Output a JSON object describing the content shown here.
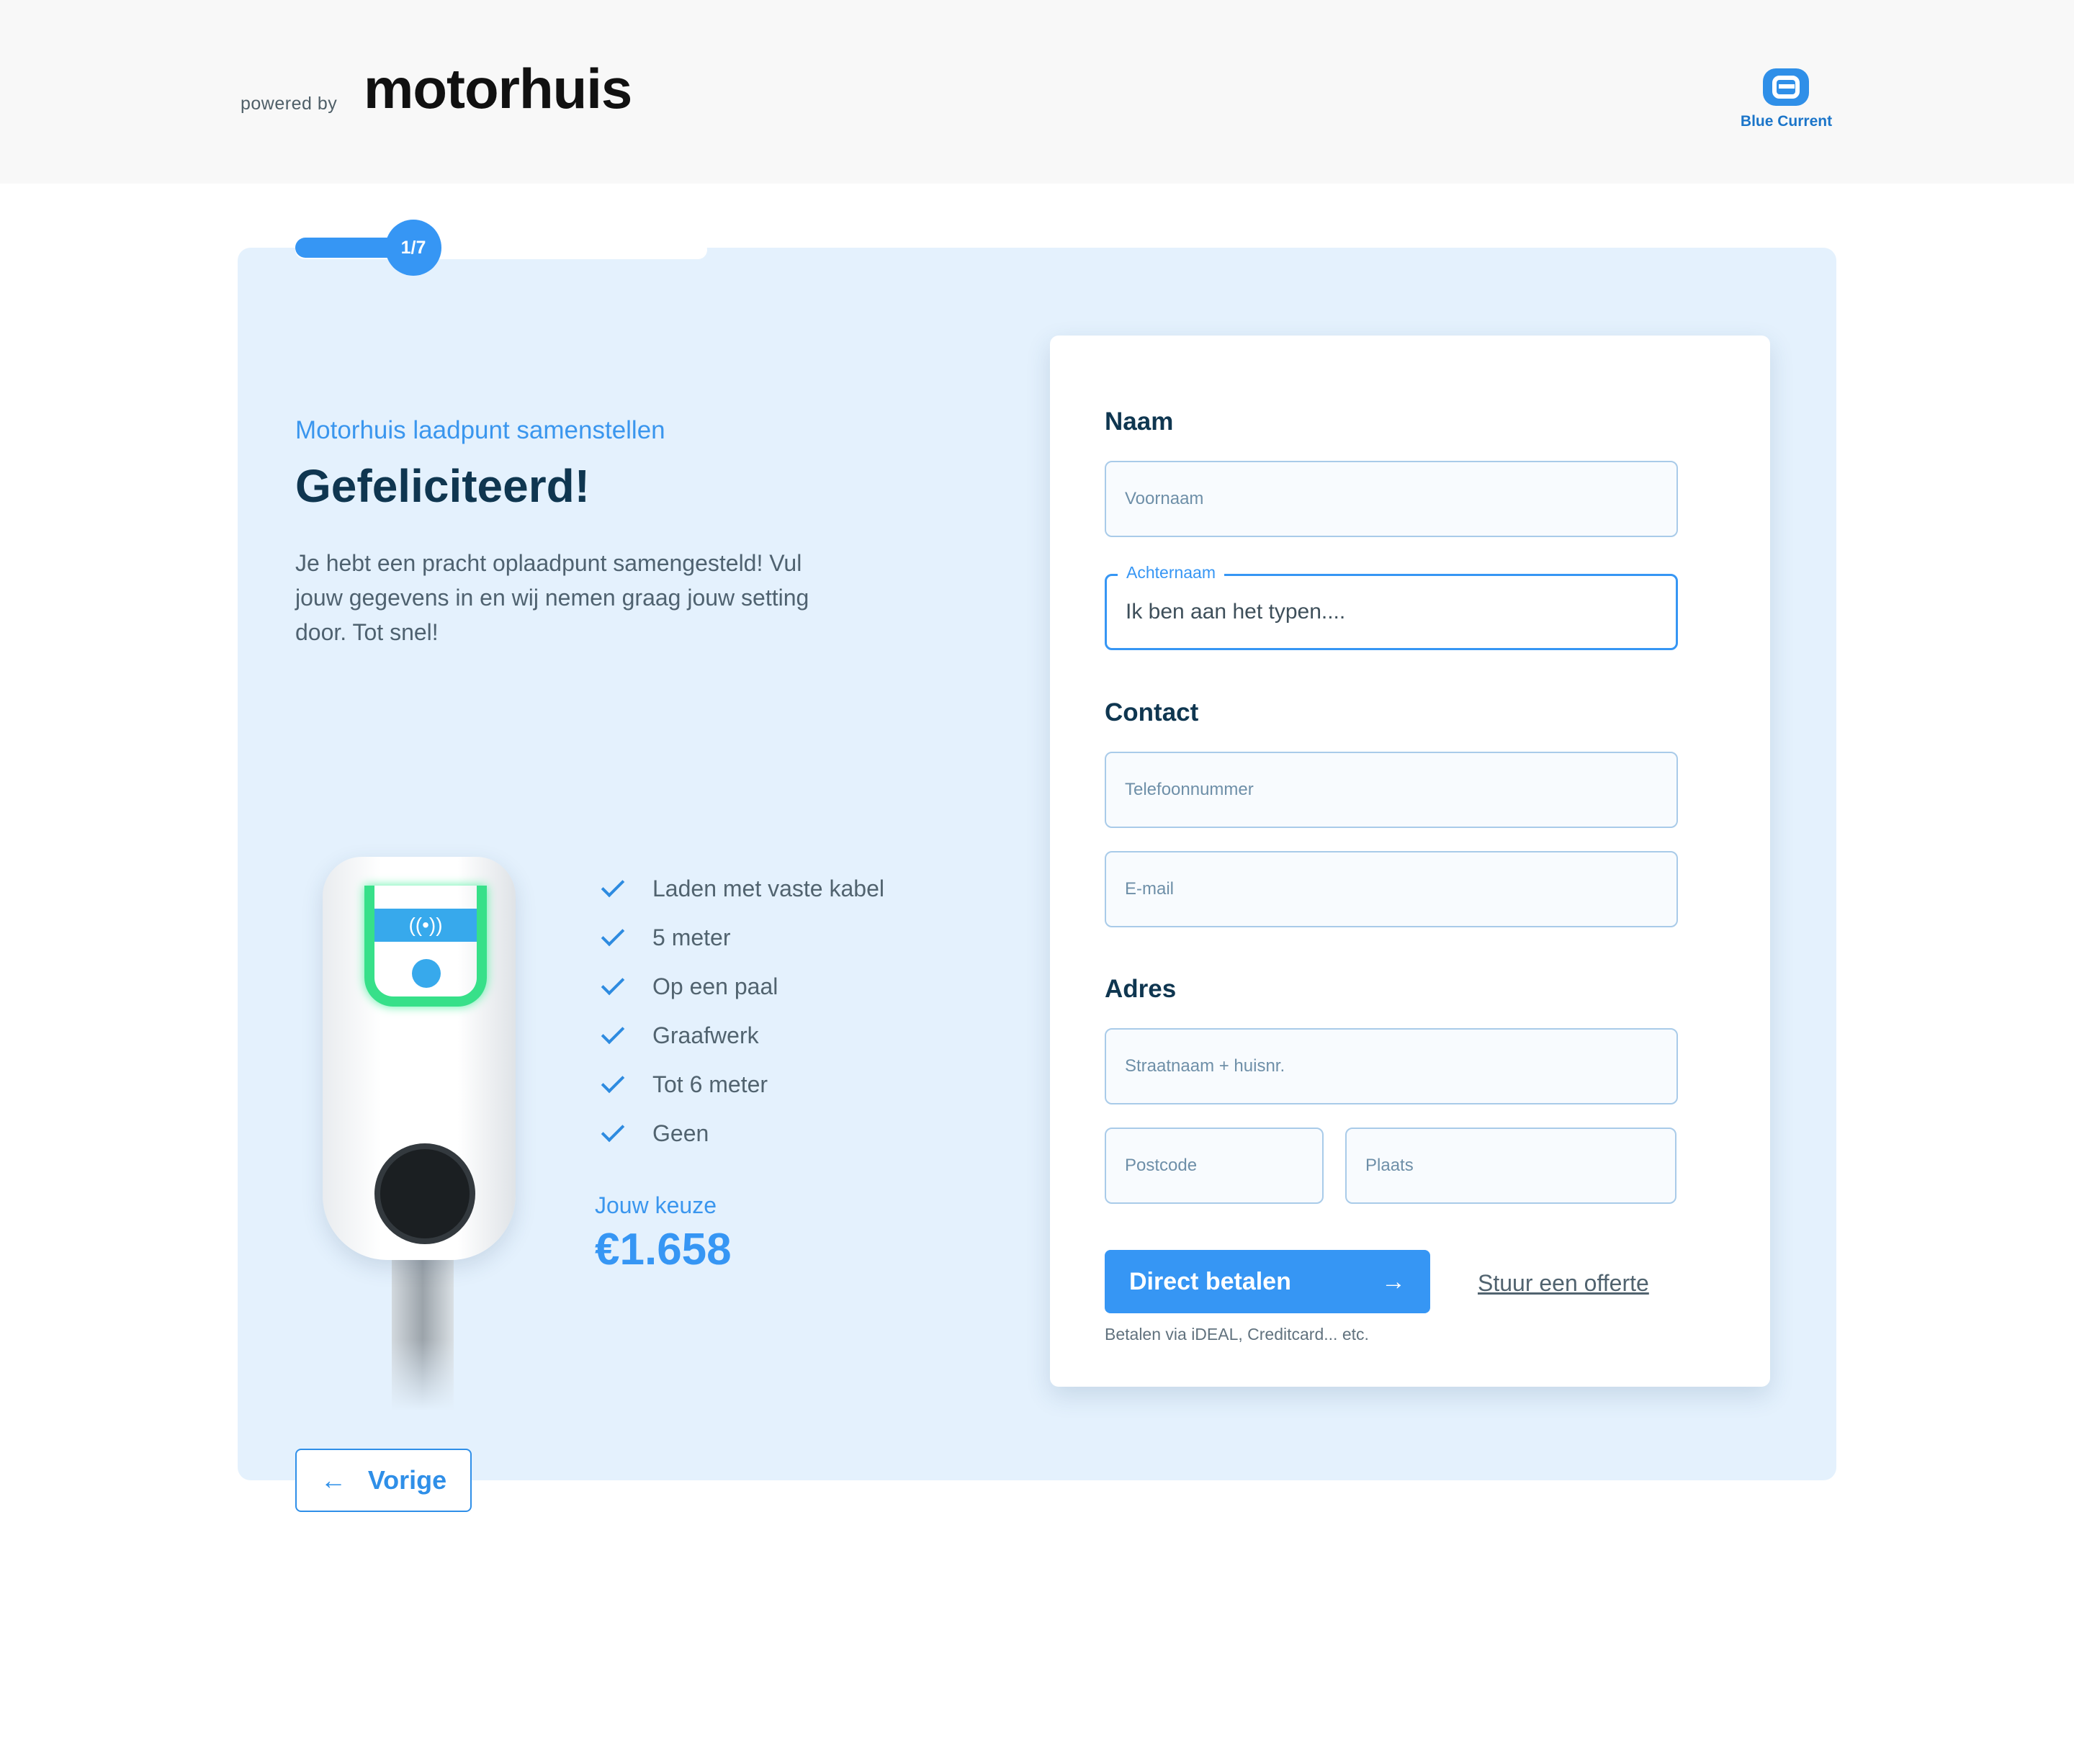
{
  "header": {
    "powered_by": "powered by",
    "brand": "motorhuis",
    "partner_logo_text": "Blue Current"
  },
  "progress": {
    "step_label": "1/7",
    "fraction": 0.14
  },
  "intro": {
    "subtitle": "Motorhuis laadpunt samenstellen",
    "title": "Gefeliciteerd!",
    "text": "Je hebt een pracht oplaadpunt samengesteld! Vul jouw gegevens in en wij nemen graag jouw setting door. Tot snel!"
  },
  "product": {
    "image_icon": "ev-charger-on-pole",
    "features": [
      "Laden met vaste kabel",
      "5 meter",
      "Op een paal",
      "Graafwerk",
      "Tot 6 meter",
      "Geen"
    ],
    "choice_label": "Jouw keuze",
    "price": "€1.658"
  },
  "form": {
    "naam_title": "Naam",
    "voornaam_placeholder": "Voornaam",
    "achternaam_label": "Achternaam",
    "achternaam_value": "Ik ben aan het typen....",
    "contact_title": "Contact",
    "telefoon_placeholder": "Telefoonnummer",
    "email_placeholder": "E-mail",
    "adres_title": "Adres",
    "straat_placeholder": "Straatnaam + huisnr.",
    "postcode_placeholder": "Postcode",
    "plaats_placeholder": "Plaats",
    "pay_button": "Direct betalen",
    "pay_arrow": "→",
    "offer_link": "Stuur een offerte",
    "pay_note": "Betalen via iDEAL, Creditcard... etc."
  },
  "nav": {
    "back_arrow": "←",
    "back_label": "Vorige"
  },
  "colors": {
    "accent": "#3696f4",
    "panel": "#e4f1fd",
    "heading": "#0f3650",
    "led": "#37e089"
  }
}
